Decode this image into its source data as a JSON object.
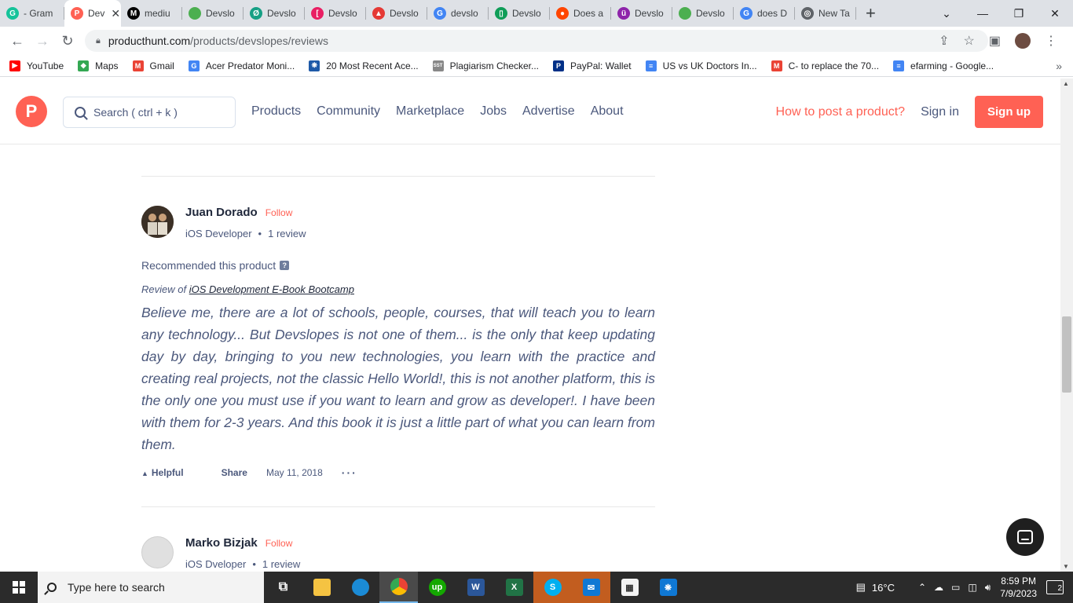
{
  "browser": {
    "tabs": [
      {
        "title": "- Gram",
        "icon_color": "#15c39a",
        "icon_char": "G"
      },
      {
        "title": "Dev",
        "icon_color": "#ff6154",
        "icon_char": "P",
        "active": true
      },
      {
        "title": "mediu",
        "icon_color": "#000000",
        "icon_char": "M"
      },
      {
        "title": "Devslo",
        "icon_color": "#4caf50",
        "icon_char": ""
      },
      {
        "title": "Devslo",
        "icon_color": "#16a085",
        "icon_char": "Ø"
      },
      {
        "title": "Devslo",
        "icon_color": "#e91e63",
        "icon_char": "["
      },
      {
        "title": "Devslo",
        "icon_color": "#e53935",
        "icon_char": "▲"
      },
      {
        "title": "devslo",
        "icon_color": "#4285f4",
        "icon_char": "G"
      },
      {
        "title": "Devslo",
        "icon_color": "#0f9d58",
        "icon_char": "▯"
      },
      {
        "title": "Does a",
        "icon_color": "#ff4500",
        "icon_char": "●"
      },
      {
        "title": "Devslo",
        "icon_color": "#8e24aa",
        "icon_char": "ü"
      },
      {
        "title": "Devslo",
        "icon_color": "#4caf50",
        "icon_char": ""
      },
      {
        "title": "does D",
        "icon_color": "#4285f4",
        "icon_char": "G"
      },
      {
        "title": "New Ta",
        "icon_color": "#5f6368",
        "icon_char": "◎"
      }
    ],
    "new_tab_label": "+",
    "url_domain": "producthunt.com",
    "url_path": "/products/devslopes/reviews",
    "bookmarks": [
      {
        "label": "YouTube",
        "color": "#ff0000",
        "char": "▶"
      },
      {
        "label": "Maps",
        "color": "#34a853",
        "char": "◆"
      },
      {
        "label": "Gmail",
        "color": "#ea4335",
        "char": "M"
      },
      {
        "label": "Acer Predator Moni...",
        "color": "#4285f4",
        "char": "G"
      },
      {
        "label": "20 Most Recent Ace...",
        "color": "#1e5aa8",
        "char": "❋"
      },
      {
        "label": "Plagiarism Checker...",
        "color": "#888888",
        "char": "SST"
      },
      {
        "label": "PayPal: Wallet",
        "color": "#003087",
        "char": "P"
      },
      {
        "label": "US vs UK Doctors In...",
        "color": "#4285f4",
        "char": "≡"
      },
      {
        "label": "C- to replace the 70...",
        "color": "#ea4335",
        "char": "M"
      },
      {
        "label": "efarming - Google...",
        "color": "#4285f4",
        "char": "≡"
      }
    ]
  },
  "header": {
    "logo_char": "P",
    "search_placeholder": "Search ( ctrl + k )",
    "nav": [
      "Products",
      "Community",
      "Marketplace",
      "Jobs",
      "Advertise",
      "About"
    ],
    "how_to": "How to post a product?",
    "sign_in": "Sign in",
    "sign_up": "Sign up"
  },
  "prev_review_actions": {
    "helpful": "Helpful",
    "share": "Share",
    "date": "May 11, 2018",
    "more": "···"
  },
  "reviews": [
    {
      "name": "Juan Dorado",
      "follow": "Follow",
      "role": "iOS Developer",
      "review_count": "1 review",
      "recommend": "Recommended this product",
      "help_mark": "?",
      "review_of_prefix": "Review of",
      "review_of_link": "iOS Development E-Book Bootcamp",
      "body": "Believe me, there are a lot of schools, people, courses, that will teach you to learn any technology... But Devslopes is not one of them... is the only that keep updating day by day, bringing to you new technologies, you learn with the practice and creating real projects, not the classic Hello World!, this is not another platform, this is the only one you must use if you want to learn and grow as developer!. I have been with them for 2-3 years. And this book it is just a little part of what you can learn from them.",
      "helpful": "Helpful",
      "share": "Share",
      "date": "May 11, 2018",
      "more": "···"
    },
    {
      "name": "Marko Bizjak",
      "follow": "Follow",
      "role": "iOS Dveloper",
      "review_count": "1 review"
    }
  ],
  "taskbar": {
    "search_placeholder": "Type here to search",
    "weather": "16°C",
    "time": "8:59 PM",
    "date": "7/9/2023",
    "notifications": "2"
  }
}
